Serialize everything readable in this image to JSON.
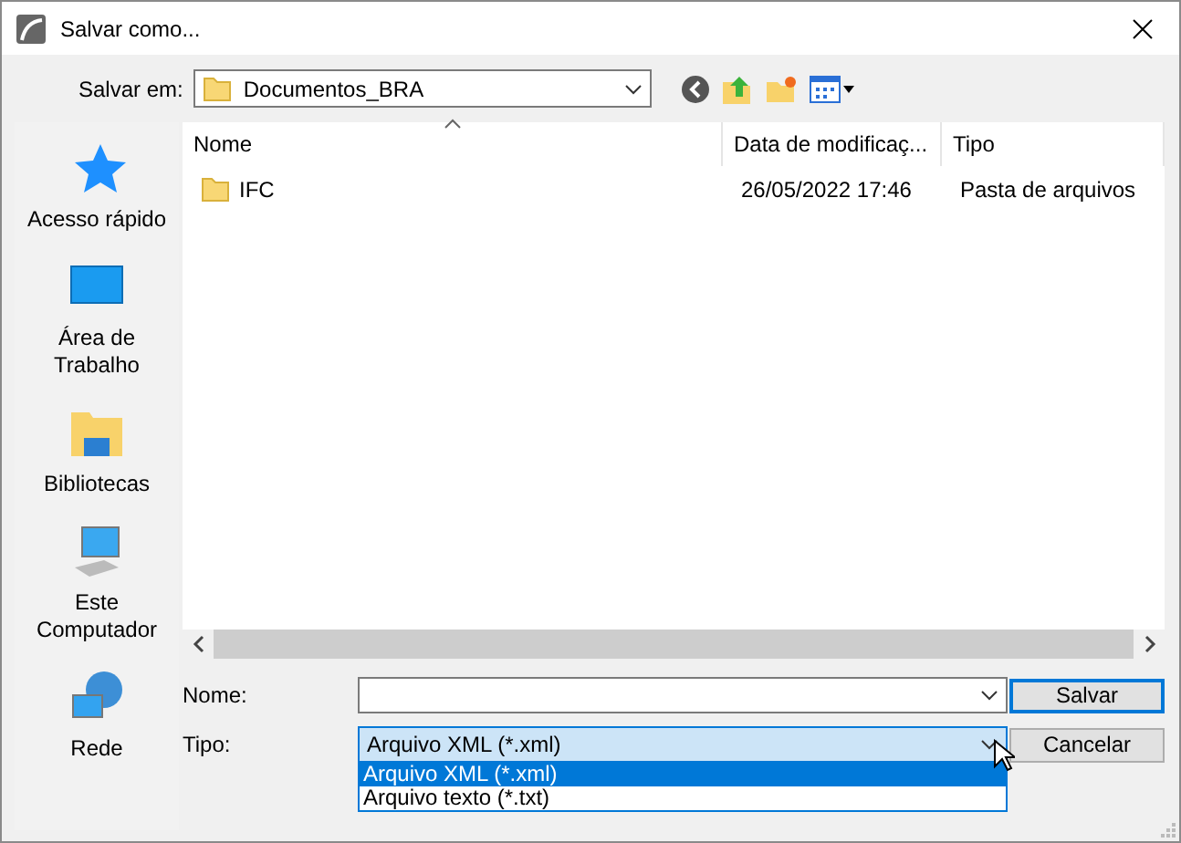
{
  "window": {
    "title": "Salvar como..."
  },
  "location": {
    "label": "Salvar em:",
    "value": "Documentos_BRA"
  },
  "sidebar": {
    "items": [
      {
        "kind": "star",
        "label": "Acesso rápido"
      },
      {
        "kind": "desktop",
        "label": "Área de Trabalho"
      },
      {
        "kind": "library",
        "label": "Bibliotecas"
      },
      {
        "kind": "computer",
        "label": "Este Computador"
      },
      {
        "kind": "network",
        "label": "Rede"
      }
    ]
  },
  "table": {
    "columns": [
      {
        "label": "Nome",
        "sorted": true
      },
      {
        "label": "Data de modificaç...",
        "sorted": false
      },
      {
        "label": "Tipo",
        "sorted": false
      }
    ],
    "rows": [
      {
        "kind": "folder",
        "cells": [
          "IFC",
          "26/05/2022 17:46",
          "Pasta de arquivos"
        ]
      }
    ]
  },
  "form": {
    "name_label": "Nome:",
    "type_label": "Tipo:",
    "type_value": "Arquivo XML (*.xml)",
    "type_open": true,
    "type_options": [
      {
        "label": "Arquivo XML (*.xml)",
        "selected": true
      },
      {
        "label": "Arquivo texto (*.txt)",
        "selected": false
      }
    ]
  },
  "buttons": [
    {
      "label": "Salvar",
      "default": true
    },
    {
      "label": "Cancelar",
      "default": false
    }
  ]
}
